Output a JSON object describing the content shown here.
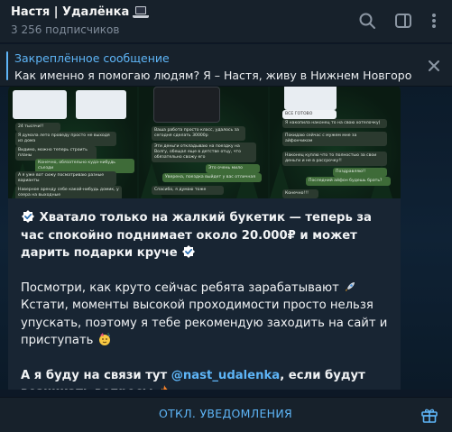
{
  "header": {
    "title": "Настя | Удалёнка",
    "title_icon": "laptop-icon",
    "subscribers": "3 256 подписчиков",
    "actions": [
      "search-icon",
      "sidebar-icon",
      "more-icon"
    ]
  },
  "pinned": {
    "title": "Закреплённое сообщение",
    "text": "Как именно я помогаю людям?  Я – Настя, живу в Нижнем Новгоро...",
    "close_icon": "close-icon"
  },
  "screenshots": {
    "left": {
      "messages": [
        "24 тысячи!!",
        "Я думала лето проведу просто не выходя из дома",
        "Видимо, можно теперь строить планы",
        "Конечно, обязательно куда-нибудь съезди",
        "А я уже вот сижу посматриваю разные варианты",
        "Наверное аренду себе какой-нибудь домик, у озера на выходные"
      ]
    },
    "middle": {
      "messages": [
        "Ваша работа просто класс, удалось за сегодня сделать 30000р",
        "Эти деньги откладываю на поездку на Волгу, обещал еще в детстве отцу, что обязательно свожу его",
        "Это очень мило",
        "Уверена, поездка выйдет у вас отличная",
        "Спасибо, я думаю тоже"
      ]
    },
    "right": {
      "messages": [
        "ВСЕ ГОТОВО",
        "Я накопила наконец то на свою хотелочку)",
        "Покидаю сейчас с мужем мне за айфончиком",
        "Наконец куплю что то полностью за свои деньги и не в рассрочку!!",
        "Поздравляю!!",
        "Последний айфон будешь брать?",
        "Конечно!!!"
      ]
    }
  },
  "post": {
    "line1": "Хватало только на жалкий букетик — теперь за час спокойно поднимает около 20.000₽ и может дарить подарки круче",
    "line2a": "Посмотри, как круто сейчас ребята зарабатывают",
    "line2b": "Кстати, моменты высокой проходимости просто нельзя упускать, поэтому я тебе рекомендую заходить на сайт и приступать",
    "line3_prefix": "А я буду на связи тут ",
    "line3_link": "@nast_udalenka",
    "line3_suffix": ", если будут возникать вопросы",
    "emojis": [
      "check-icon",
      "rocket-icon",
      "party-face-icon",
      "fire-icon"
    ]
  },
  "footer": {
    "mute_label": "ОТКЛ. УВЕДОМЛЕНИЯ",
    "gift_icon": "gift-icon"
  },
  "colors": {
    "accent": "#5eb5f7",
    "header_bg": "#17212b",
    "bubble_bg": "#182533",
    "text": "#f1f3f5",
    "muted": "#7f8b99"
  }
}
